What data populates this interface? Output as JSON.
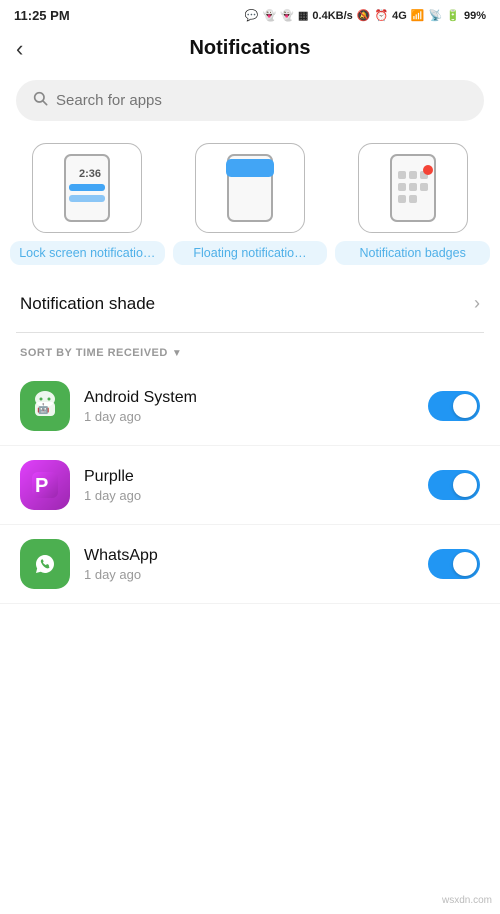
{
  "statusBar": {
    "time": "11:25 PM",
    "batteryPercent": "99%",
    "speed": "0.4KB/s"
  },
  "header": {
    "backLabel": "‹",
    "title": "Notifications"
  },
  "search": {
    "placeholder": "Search for apps"
  },
  "notifTypes": [
    {
      "id": "lock-screen",
      "label": "Lock screen notificatio…"
    },
    {
      "id": "floating",
      "label": "Floating notificatio…"
    },
    {
      "id": "badge",
      "label": "Notification badges"
    }
  ],
  "notifShade": {
    "label": "Notification shade",
    "chevron": "›"
  },
  "sortLabel": "SORT BY TIME RECEIVED",
  "apps": [
    {
      "id": "android-system",
      "name": "Android System",
      "time": "1 day ago",
      "iconType": "android",
      "toggleOn": true
    },
    {
      "id": "purplle",
      "name": "Purplle",
      "time": "1 day ago",
      "iconType": "purplle",
      "toggleOn": true
    },
    {
      "id": "whatsapp",
      "name": "WhatsApp",
      "time": "1 day ago",
      "iconType": "whatsapp",
      "toggleOn": true
    }
  ],
  "colors": {
    "toggleOn": "#2196f3",
    "cardLabelBg": "#e8f5fd",
    "cardLabelText": "#4fb0e8"
  }
}
